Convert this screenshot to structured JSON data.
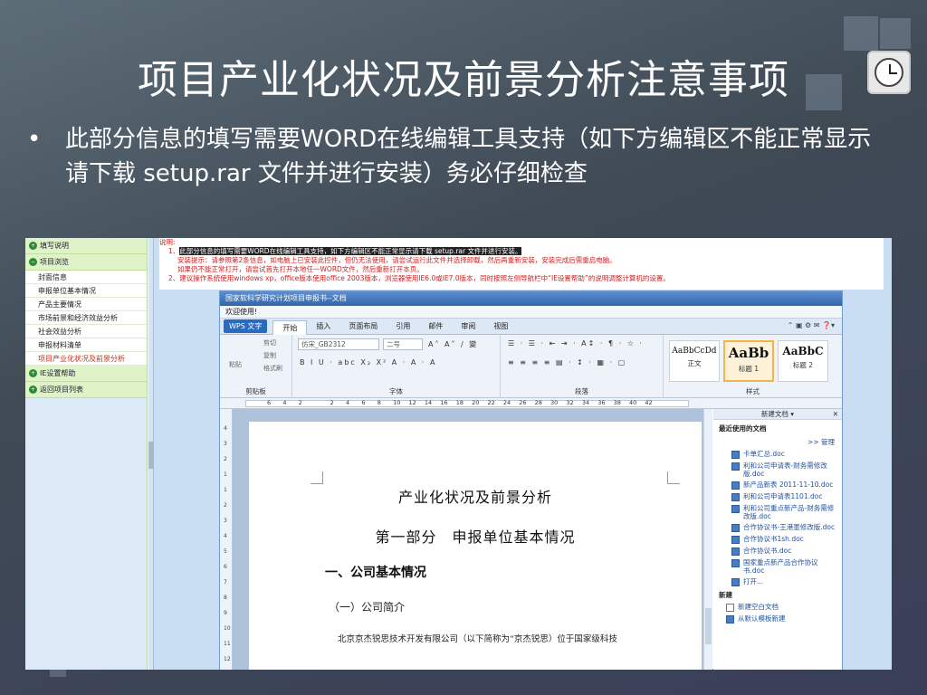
{
  "slide": {
    "title": "项目产业化状况及前景分析注意事项",
    "bullet_symbol": "•",
    "bullet_text": "此部分信息的填写需要WORD在线编辑工具支持（如下方编辑区不能正常显示请下载 setup.rar 文件并进行安装）务必仔细检查"
  },
  "left_nav": {
    "groups": [
      {
        "label": "填写说明",
        "icon": "plus-circle-icon"
      },
      {
        "label": "项目浏览",
        "icon": "minus-circle-icon"
      }
    ],
    "items": [
      {
        "label": "封面信息",
        "active": false
      },
      {
        "label": "申报单位基本情况",
        "active": false
      },
      {
        "label": "产品主要情况",
        "active": false
      },
      {
        "label": "市场前景和经济效益分析",
        "active": false
      },
      {
        "label": "社会效益分析",
        "active": false
      },
      {
        "label": "申报材料清单",
        "active": false
      },
      {
        "label": "项目产业化状况及前景分析",
        "active": true
      }
    ],
    "groups_bottom": [
      {
        "label": "IE设置帮助",
        "icon": "plus-circle-icon"
      },
      {
        "label": "返回项目列表",
        "icon": "plus-circle-icon"
      }
    ]
  },
  "notes": {
    "label": "说明:",
    "line1_num": "1、",
    "line1_highlight": "此部分信息的填写需要WORD在线编辑工具支持，如下方编辑区不能正常显示请下载 setup.rar 文件并进行安装。",
    "line2": "安装提示：请参照第2条信息，如电脑上已安装此控件，但仍无法使用，请尝试运行此文件并选择卸载，然后再重新安装，安装完成后需重启电脑。",
    "line3": "如果仍不能正常打开，请尝试首先打开本地任一WORD文件，然后重新打开本页。",
    "line4": "2、建议操作系统使用windows xp，office版本使用office 2003版本，浏览器使用IE6.0或IE7.0版本，同时按照左侧导航栏中“IE设置帮助”的说明调整计算机的设置。"
  },
  "editor": {
    "window_title": "国家软科学研究计划项目申报书--文档",
    "welcome": "欢迎使用!",
    "app_button": "WPS 文字",
    "tabs": [
      "开始",
      "插入",
      "页面布局",
      "引用",
      "邮件",
      "审阅",
      "视图"
    ],
    "active_tab": "开始",
    "clipboard": {
      "paste": "粘贴",
      "cut": "剪切",
      "copy": "复制",
      "format_painter": "格式刷",
      "caption": "剪贴板"
    },
    "font": {
      "family": "仿宋_GB2312",
      "size": "二号",
      "caption": "字体"
    },
    "paragraph_caption": "段落",
    "styles": [
      {
        "preview": "AaBbCcDd",
        "name": "正文",
        "selected": false
      },
      {
        "preview": "AaBb",
        "name": "标题 1",
        "selected": true
      },
      {
        "preview": "AaBbC",
        "name": "标题 2",
        "selected": false
      }
    ],
    "styles_caption": "样式",
    "ruler_numbers": [
      "6",
      "4",
      "2",
      "",
      "2",
      "4",
      "6",
      "8",
      "10",
      "12",
      "14",
      "16",
      "18",
      "20",
      "22",
      "24",
      "26",
      "28",
      "30",
      "32",
      "34",
      "36",
      "38",
      "40",
      "42"
    ],
    "vruler_numbers": [
      "4",
      "3",
      "2",
      "1",
      "1",
      "2",
      "3",
      "4",
      "5",
      "6",
      "7",
      "8",
      "9",
      "10",
      "11",
      "12"
    ],
    "document": {
      "title": "产业化状况及前景分析",
      "part": "第一部分　申报单位基本情况",
      "section": "一、公司基本情况",
      "subsection": "（一）公司简介",
      "paragraph": "北京京杰锐思技术开发有限公司（以下简称为“京杰锐思）位于国家级科技"
    },
    "task_pane": {
      "header": "新建文档 ▾",
      "recent_label": "最近使用的文档",
      "manage": ">> 管理",
      "recent_files": [
        "卡单汇总.doc",
        "利和公司申请表-财务需修改版.doc",
        "新产品新表 2011-11-10.doc",
        "利和公司申请表1101.doc",
        "利和公司重点新产品-财务需修改版.doc",
        "合作协议书-王港墨修改版.doc",
        "合作协议书1sh.doc",
        "合作协议书.doc",
        "国家重点新产品合作协议书.doc",
        "打开..."
      ],
      "new_label": "新建",
      "new_items": [
        "新建空白文档",
        "从默认模板新建"
      ]
    }
  }
}
